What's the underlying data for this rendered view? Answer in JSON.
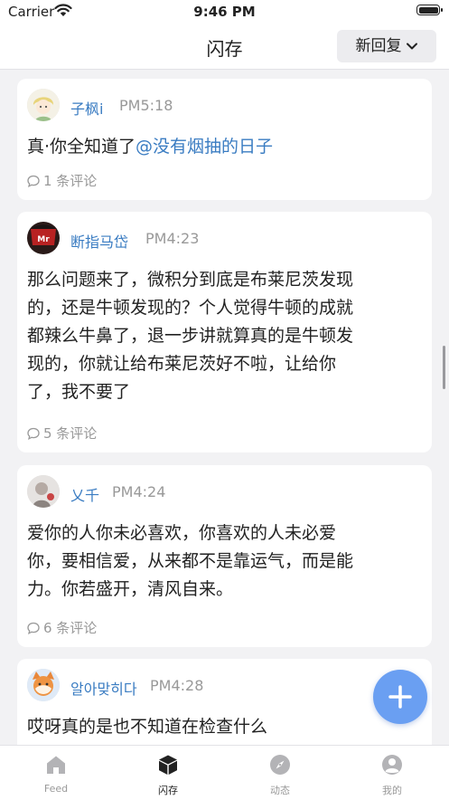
{
  "status_bar": {
    "carrier": "Carrier",
    "time": "9:46 PM"
  },
  "nav": {
    "title": "闪存",
    "sort_label": "新回复"
  },
  "posts": [
    {
      "author": "子枫i",
      "time": "PM5:18",
      "content_prefix": "真·你全知道了",
      "mention": "@没有烟抽的日子",
      "comments": "1 条评论"
    },
    {
      "author": "断指马岱",
      "time": "PM4:23",
      "lines": [
        "那么问题来了，微积分到底是布莱尼茨发现",
        "的，还是牛顿发现的？个人觉得牛顿的成就",
        "都辣么牛鼻了，退一步讲就算真的是牛顿发",
        "现的，你就让给布莱尼茨好不啦，让给你",
        "了，我不要了"
      ],
      "comments": "5 条评论"
    },
    {
      "author": "乂千",
      "time": "PM4:24",
      "lines": [
        "爱你的人你未必喜欢，你喜欢的人未必爱",
        "你，要相信爱，从来都不是靠运气，而是能",
        "力。你若盛开，清风自来。"
      ],
      "comments": "6 条评论"
    },
    {
      "author": "알아맞히다",
      "time": "PM4:28",
      "lines": [
        "哎呀真的是也不知道在检查什么"
      ]
    }
  ],
  "tabs": [
    {
      "label": "Feed",
      "icon": "home-icon"
    },
    {
      "label": "闪存",
      "icon": "cube-icon",
      "active": true
    },
    {
      "label": "动态",
      "icon": "compass-icon"
    },
    {
      "label": "我的",
      "icon": "profile-icon"
    }
  ],
  "colors": {
    "accent": "#3a7cc2",
    "fab": "#6a9ff2",
    "background": "#f2f2f4"
  }
}
